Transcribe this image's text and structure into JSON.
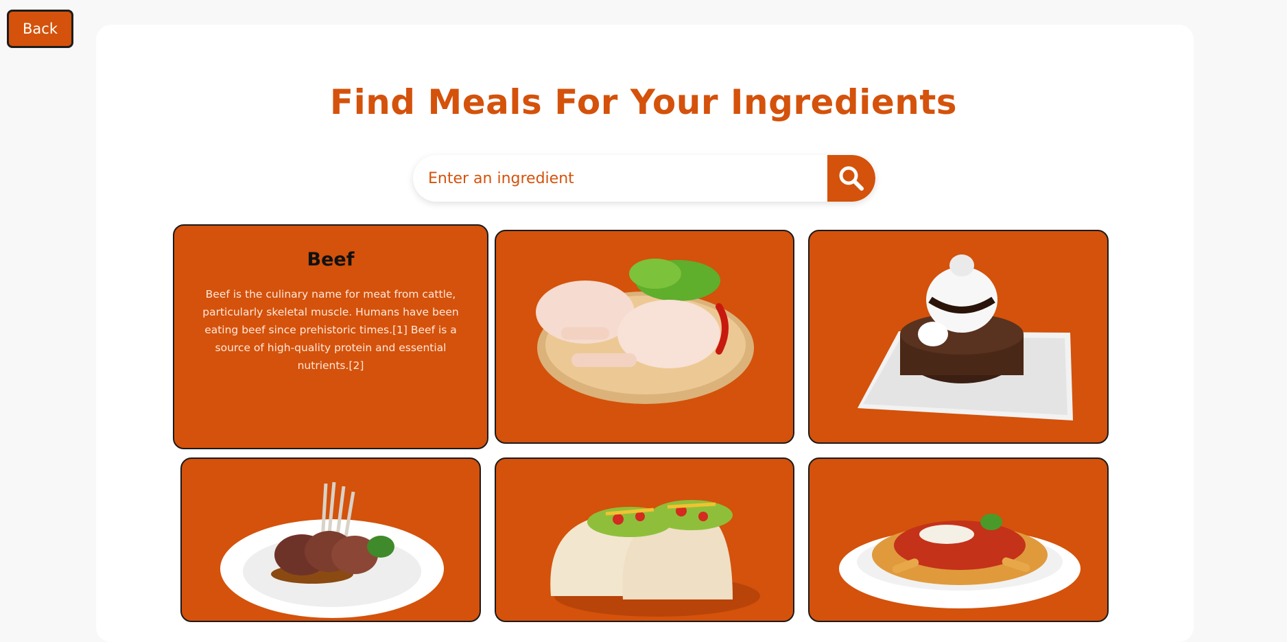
{
  "back_label": "Back",
  "page_title": "Find Meals For Your Ingredients",
  "search": {
    "placeholder": "Enter an ingredient",
    "value": ""
  },
  "icons": {
    "search": "search-icon"
  },
  "colors": {
    "accent": "#d4520b",
    "background": "#f8f8f8",
    "panel": "#ffffff"
  },
  "cards": [
    {
      "title": "Beef",
      "description": "Beef is the culinary name for meat from cattle, particularly skeletal muscle. Humans have been eating beef since prehistoric times.[1] Beef is a source of high-quality protein and essential nutrients.[2]"
    },
    {
      "image": "chicken-image"
    },
    {
      "image": "dessert-image"
    },
    {
      "image": "lamb-image"
    },
    {
      "image": "tacos-image"
    },
    {
      "image": "pasta-image"
    }
  ]
}
